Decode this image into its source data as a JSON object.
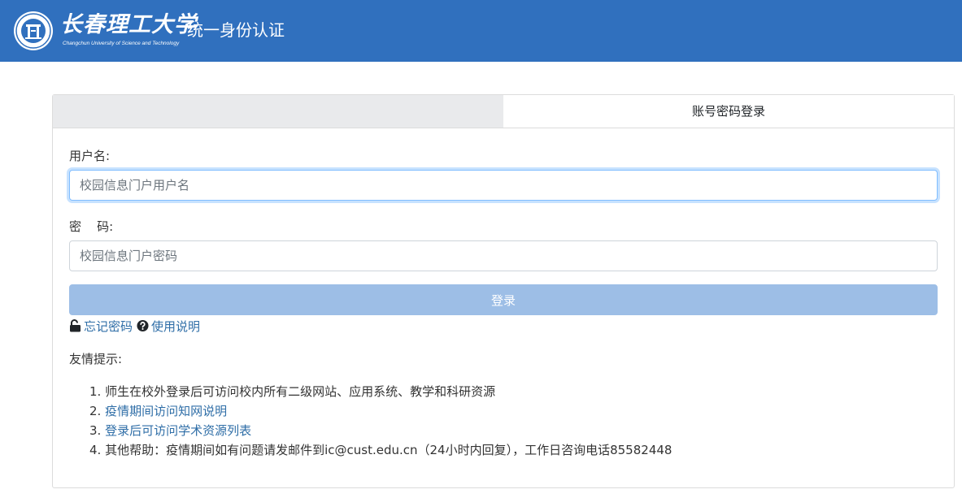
{
  "header": {
    "logo_cn": "长春理工大学",
    "logo_en": "Changchun University of Science and Technology",
    "system_title": "统一身份认证"
  },
  "tabs": {
    "account_login": "账号密码登录"
  },
  "form": {
    "username_label": "用户名:",
    "username_placeholder": "校园信息门户用户名",
    "username_value": "",
    "password_label": "密    码:",
    "password_placeholder": "校园信息门户密码",
    "password_value": "",
    "login_button": "登录"
  },
  "helpers": {
    "forgot_password": "忘记密码",
    "usage_guide": "使用说明"
  },
  "tips": {
    "title": "友情提示:",
    "items": [
      {
        "num": "1.",
        "text": "师生在校外登录后可访问校内所有二级网站、应用系统、教学和科研资源"
      },
      {
        "num": "2.",
        "text": "疫情期间访问知网说明"
      },
      {
        "num": "3.",
        "text": "登录后可访问学术资源列表"
      },
      {
        "num": "4.",
        "text": "其他帮助：疫情期间如有问题请发邮件到ic@cust.edu.cn（24小时内回复），工作日咨询电话85582448"
      }
    ]
  },
  "colors": {
    "header_bg": "#3070be",
    "link": "#2f6ea7",
    "button_disabled": "#9dbee6"
  },
  "icons": [
    "university-seal-icon",
    "unlock-icon",
    "question-circle-icon"
  ]
}
